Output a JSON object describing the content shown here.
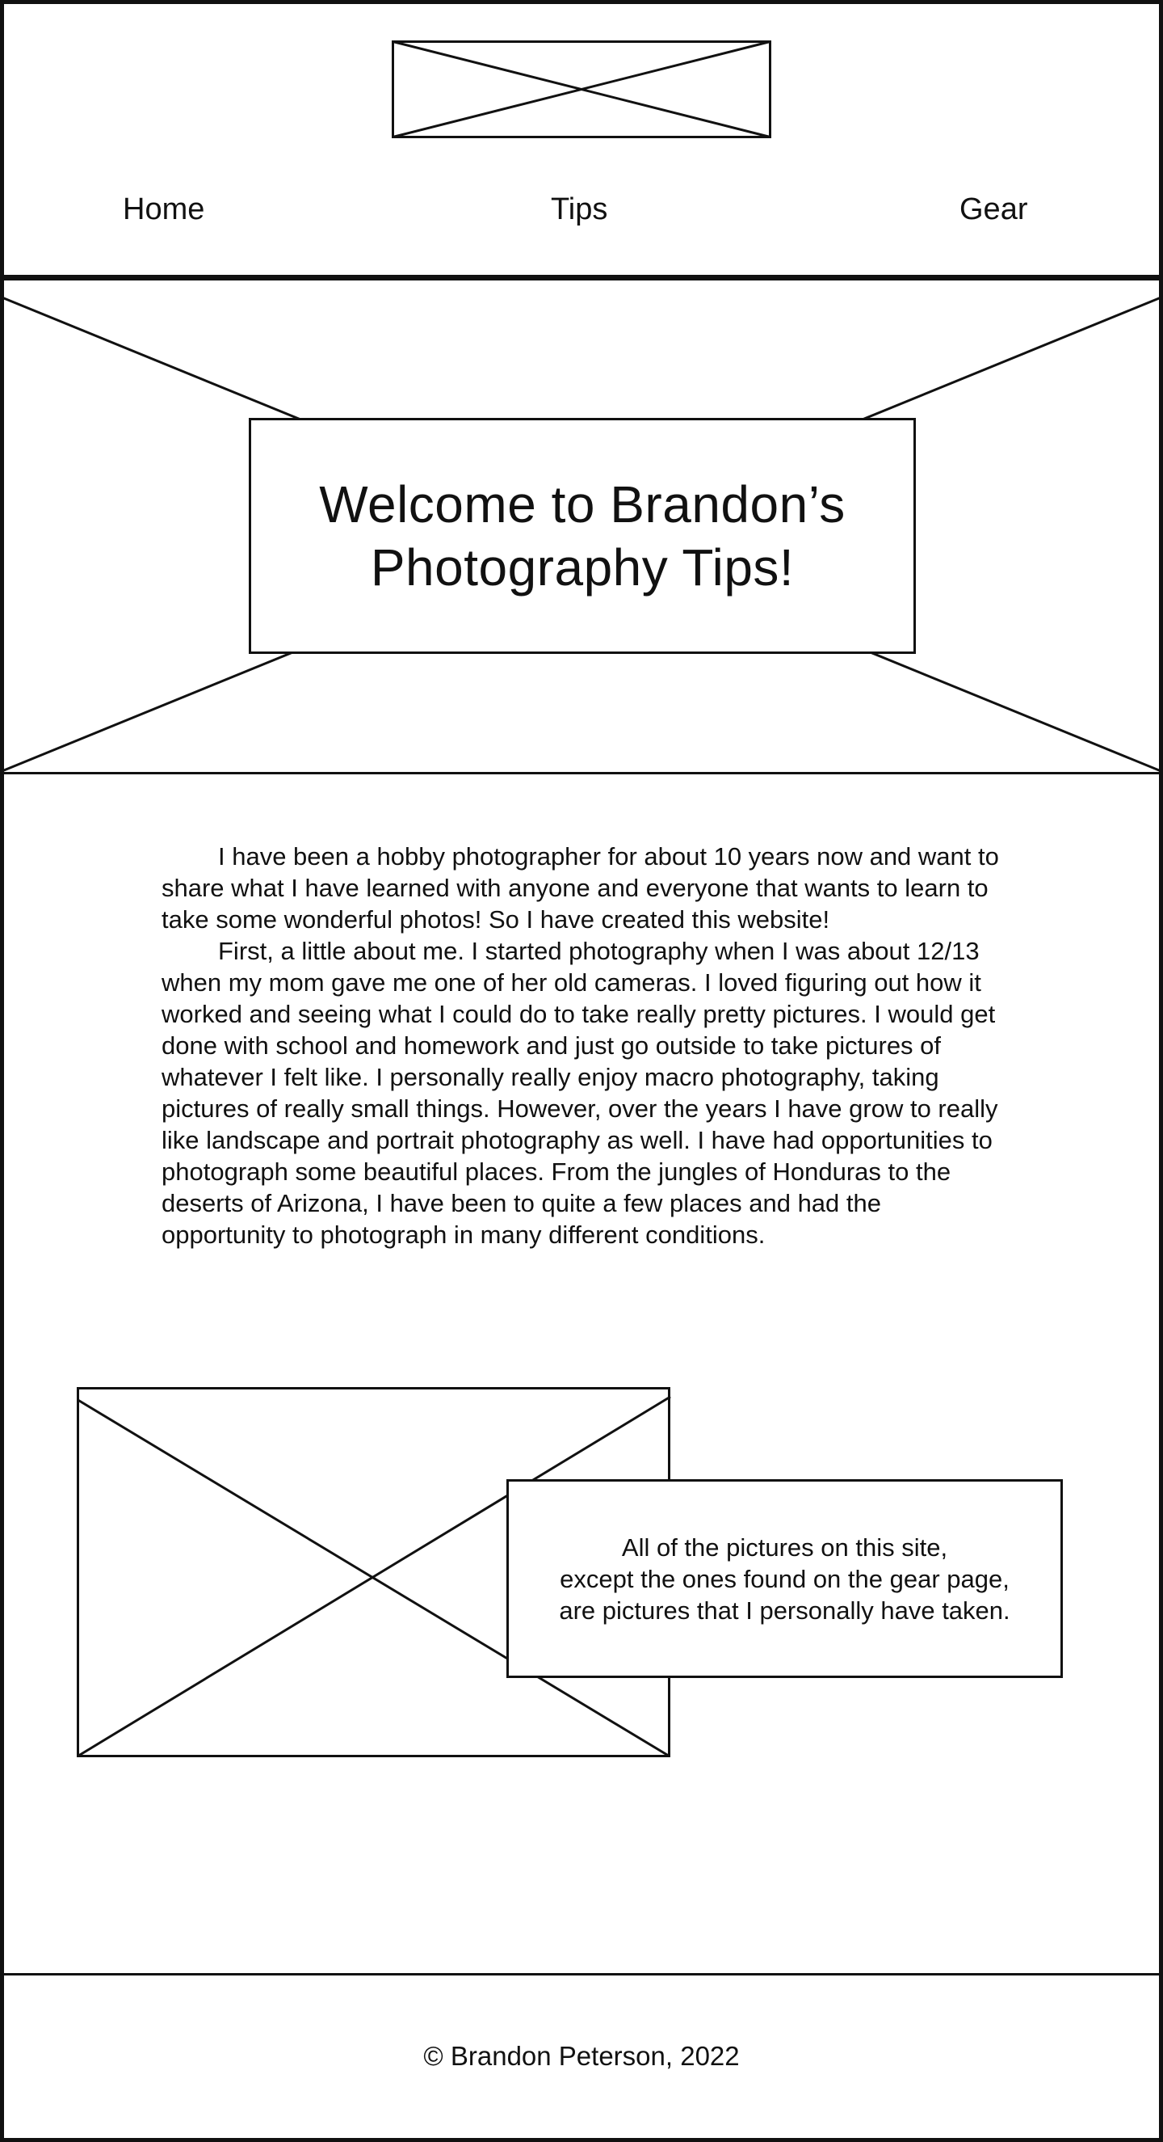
{
  "nav": {
    "home_label": "Home",
    "tips_label": "Tips",
    "gear_label": "Gear"
  },
  "hero": {
    "title_line1": "Welcome to Brandon’s",
    "title_line2": "Photography Tips!"
  },
  "intro": {
    "paragraph1": "I have been a hobby photographer for about 10 years now and want to share what I have learned with anyone and everyone that wants to learn to take some wonderful photos! So I have created this website!",
    "paragraph2": "First, a little about me. I started photography when I was about 12/13 when my mom gave me one of her old cameras. I loved figuring out how it worked and seeing what I could do to take really pretty pictures. I would get done with school and homework and just go outside to take pictures of whatever I felt like. I personally really enjoy macro photography, taking pictures of really small things. However, over the years I have grow to really like landscape and portrait photography as well. I have had opportunities to photograph some beautiful places. From the jungles of Honduras to the deserts of Arizona, I have been to quite a few places and had the opportunity to photograph in many different conditions."
  },
  "photo_note": {
    "line1": "All of the pictures on this site,",
    "line2": "except the ones found on the gear page,",
    "line3": "are pictures that I personally have taken."
  },
  "footer": {
    "copyright": "© Brandon Peterson, 2022"
  },
  "colors": {
    "stroke": "#111111",
    "background": "#ffffff"
  }
}
